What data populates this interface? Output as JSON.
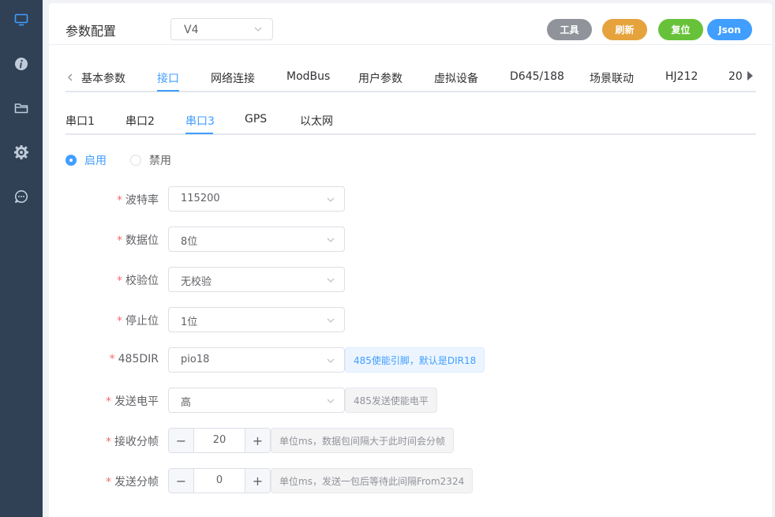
{
  "sidebar": {
    "icons": [
      "monitor-icon",
      "info-icon",
      "folder-icon",
      "gear-icon",
      "chat-icon"
    ]
  },
  "header": {
    "title": "参数配置",
    "version": "V4",
    "buttons": {
      "tools": "工具",
      "refresh": "刷新",
      "reset": "复位",
      "json": "Json"
    }
  },
  "tabs": [
    "基本参数",
    "接口",
    "网络连接",
    "ModBus",
    "用户参数",
    "虚拟设备",
    "D645/188",
    "场景联动",
    "HJ212",
    "20"
  ],
  "active_tab": "接口",
  "sub_tabs": [
    "串口1",
    "串口2",
    "串口3",
    "GPS",
    "以太网"
  ],
  "active_sub_tab": "串口3",
  "enable": {
    "on_label": "启用",
    "off_label": "禁用",
    "selected": "启用"
  },
  "form": {
    "baud": {
      "label": "波特率",
      "value": "115200"
    },
    "data_bits": {
      "label": "数据位",
      "value": "8位"
    },
    "parity": {
      "label": "校验位",
      "value": "无校验"
    },
    "stop_bits": {
      "label": "停止位",
      "value": "1位"
    },
    "dir485": {
      "label": "485DIR",
      "value": "pio18",
      "hint": "485使能引脚，默认是DIR18"
    },
    "send_level": {
      "label": "发送电平",
      "value": "高",
      "hint": "485发送使能电平"
    },
    "recv_frame": {
      "label": "接收分帧",
      "value": "20",
      "hint": "单位ms，数据包间隔大于此时间会分帧"
    },
    "send_frame": {
      "label": "发送分帧",
      "value": "0",
      "hint": "单位ms，发送一包后等待此间隔From2324"
    }
  },
  "colors": {
    "sidebar": "#304156",
    "primary": "#409eff",
    "required": "#f56c6c"
  }
}
